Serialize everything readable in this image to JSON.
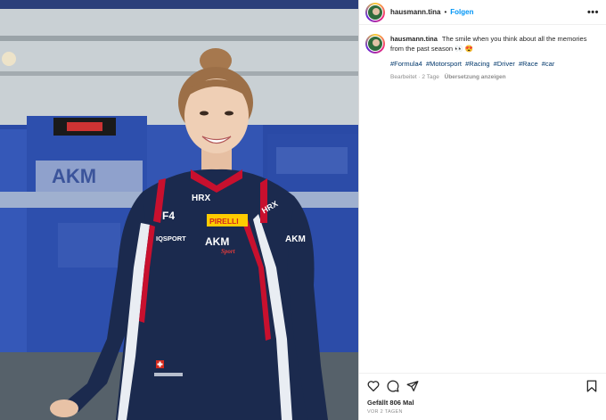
{
  "post": {
    "username": "hausmann.tina",
    "follow_label": "Folgen",
    "more_label": "•••",
    "separator": "•",
    "caption": "The smile when you think about all the memories from the past season 👀 😍",
    "hashtags": [
      "#Formula4",
      "#Motorsport",
      "#Racing",
      "#Driver",
      "#Race",
      "#car"
    ],
    "edited": "Bearbeitet · 2 Tage",
    "translate": "Übersetzung anzeigen",
    "likes": "Gefällt 806 Mal",
    "date": "VOR 2 TAGEN"
  },
  "photo_text": {
    "sponsor_pirelli": "PIRELLI",
    "sponsor_akm": "AKM",
    "sponsor_sport": "Sport",
    "sponsor_hrx": "HRX",
    "sponsor_f4": "F4",
    "sponsor_iqsport": "IQSPORT",
    "banner_akm": "AKM"
  },
  "icons": {
    "like": "heart-icon",
    "comment": "comment-icon",
    "share": "share-icon",
    "save": "bookmark-icon",
    "more": "more-icon"
  },
  "colors": {
    "link": "#0095f6",
    "hashtag": "#00376b",
    "suit": "#1b2a4e",
    "suit_red": "#c8102e"
  }
}
